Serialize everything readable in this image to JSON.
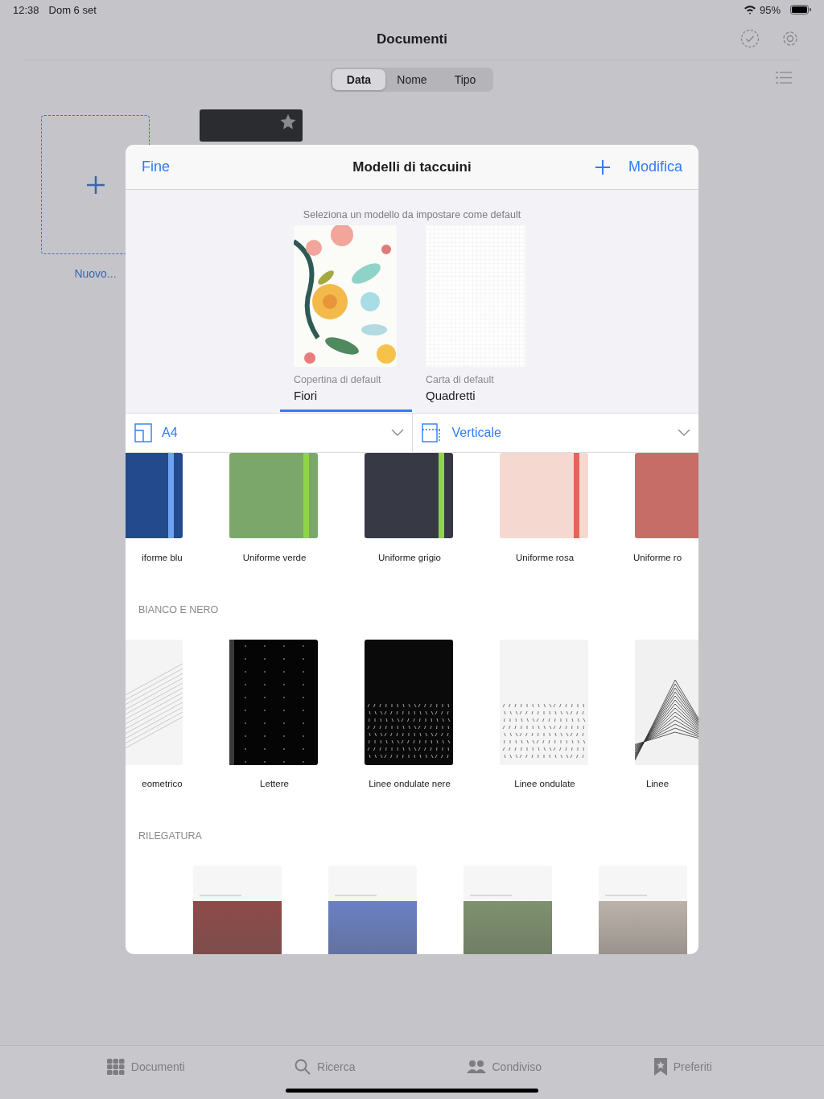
{
  "status_bar": {
    "time": "12:38",
    "date": "Dom 6 set",
    "battery": "95%"
  },
  "nav": {
    "title": "Documenti"
  },
  "sort_segments": [
    {
      "label": "Data",
      "selected": true
    },
    {
      "label": "Nome",
      "selected": false
    },
    {
      "label": "Tipo",
      "selected": false
    }
  ],
  "new_document": {
    "label": "Nuovo..."
  },
  "sheet": {
    "done": "Fine",
    "title": "Modelli di taccuini",
    "edit": "Modifica",
    "hint": "Seleziona un modello da impostare come default",
    "defaults": [
      {
        "kind": "cover",
        "caption": "Copertina di default",
        "value": "Fiori",
        "selected": true
      },
      {
        "kind": "paper",
        "caption": "Carta di default",
        "value": "Quadretti",
        "selected": false
      }
    ],
    "size": {
      "value": "A4"
    },
    "orientation": {
      "value": "Verticale"
    },
    "sections": [
      {
        "items": [
          {
            "kind": "solid",
            "label": "iforme blu",
            "color": "#234a8c",
            "band": {
              "color": "#6fa2f0"
            }
          },
          {
            "kind": "solid",
            "label": "Uniforme verde",
            "color": "#7ba86a",
            "band": {
              "color": "#8fd44e"
            }
          },
          {
            "kind": "solid",
            "label": "Uniforme grigio",
            "color": "#373a44",
            "band": {
              "color": "#8fd44e"
            }
          },
          {
            "kind": "solid",
            "label": "Uniforme rosa",
            "color": "#f5d9d0",
            "band": {
              "color": "#e8625a"
            }
          },
          {
            "kind": "solid",
            "label": "Uniforme ro",
            "color": "#c66d68"
          }
        ]
      },
      {
        "title": "BIANCO E NERO",
        "items": [
          {
            "kind": "geometric",
            "label": "eometrico"
          },
          {
            "kind": "letters",
            "label": "Lettere"
          },
          {
            "kind": "waves_dark",
            "label": "Linee ondulate nere"
          },
          {
            "kind": "waves",
            "label": "Linee ondulate"
          },
          {
            "kind": "stripes",
            "label": "Linee"
          }
        ]
      },
      {
        "title": "RILEGATURA",
        "items": [
          {
            "kind": "binding",
            "color": "#8f4a48"
          },
          {
            "kind": "binding",
            "color": "#6a80c4"
          },
          {
            "kind": "binding",
            "color": "#7e926e"
          },
          {
            "kind": "binding",
            "color": "#bcb2a9"
          }
        ]
      }
    ]
  },
  "tab_bar": [
    {
      "kind": "grid",
      "label": "Documenti"
    },
    {
      "kind": "search",
      "label": "Ricerca"
    },
    {
      "kind": "people",
      "label": "Condiviso"
    },
    {
      "kind": "bookmark",
      "label": "Preferiti"
    }
  ]
}
